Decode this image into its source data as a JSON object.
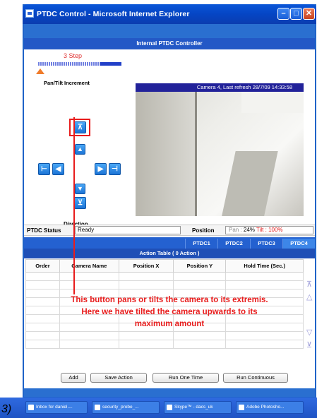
{
  "window": {
    "title": "PTDC Control - Microsoft Internet Explorer",
    "min_icon": "minimize-icon",
    "max_icon": "maximize-icon",
    "close_icon": "close-icon"
  },
  "header": {
    "title": "Internal PTDC Controller"
  },
  "controls": {
    "step_label": "3 Step",
    "pan_tilt_label": "Pan/Tilt Increment",
    "direction_label": "Direction",
    "buttons": {
      "up_max": "⊼",
      "up": "▲",
      "left_max": "⊢",
      "left": "◀",
      "right": "▶",
      "right_max": "⊣",
      "down": "▼",
      "down_max": "⊻"
    }
  },
  "camera": {
    "caption": "Camera 4, Last refresh 28/7/09 14:33:58"
  },
  "status": {
    "label": "PTDC Status",
    "value": "Ready",
    "position_label": "Position",
    "pan_label": "Pan :",
    "pan_value": "24%",
    "tilt_label": "Tilt :",
    "tilt_value": "100%"
  },
  "tabs": [
    "PTDC1",
    "PTDC2",
    "PTDC3",
    "PTDC4"
  ],
  "action_table": {
    "title": "Action Table  ( 0 Action )",
    "columns": [
      "Order",
      "Camera Name",
      "Position X",
      "Position Y",
      "Hold Time (Sec.)"
    ]
  },
  "annotation": {
    "line1": "This button pans or tilts the camera to its extremis.",
    "line2": "Here we have tilted the camera upwards to its",
    "line3": "maximum amount"
  },
  "actions": {
    "add": "Add",
    "save": "Save Action",
    "run_once": "Run One Time",
    "run_continuous": "Run Continuous"
  },
  "taskbar": {
    "items": [
      "Inbox for daniel....",
      "security_probe_...",
      "Skype™ - dacs_uk",
      "Adobe Photosho..."
    ]
  },
  "figure_label": "3)",
  "colors": {
    "accent_red": "#e81c1c",
    "titlebar_blue": "#0a56d8"
  }
}
